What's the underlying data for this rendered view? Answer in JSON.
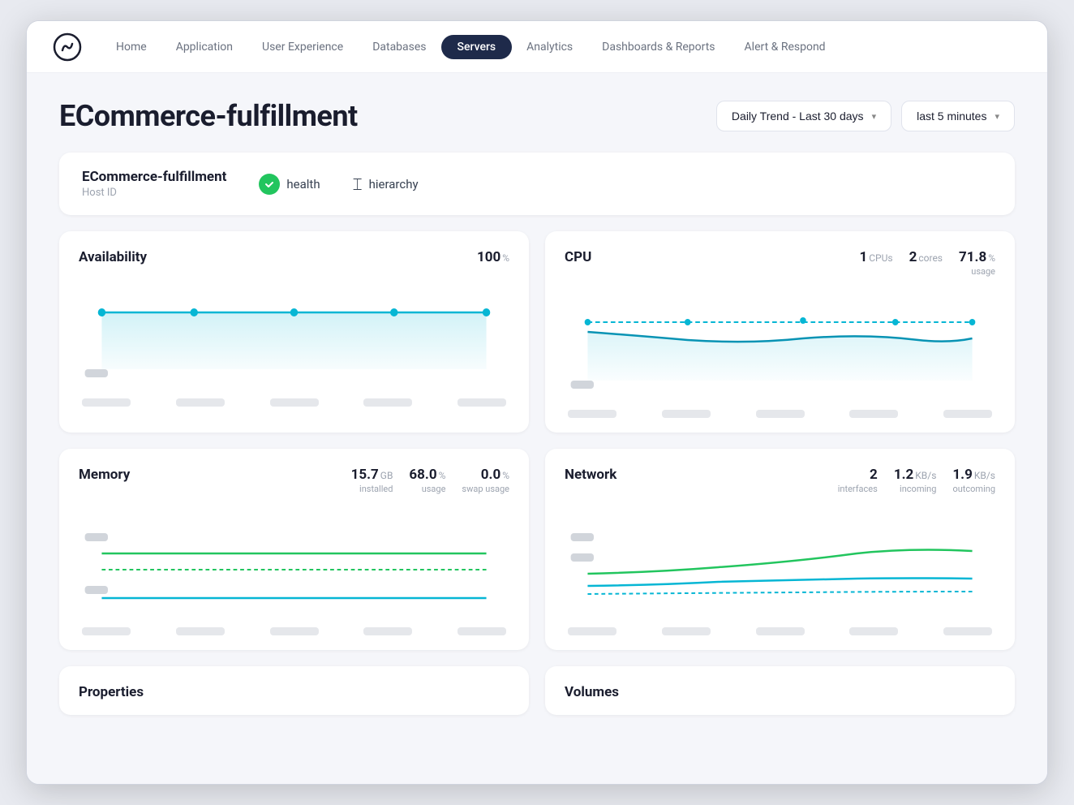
{
  "nav": {
    "logo_alt": "logo",
    "items": [
      {
        "label": "Home",
        "active": false
      },
      {
        "label": "Application",
        "active": false
      },
      {
        "label": "User Experience",
        "active": false
      },
      {
        "label": "Databases",
        "active": false
      },
      {
        "label": "Servers",
        "active": true
      },
      {
        "label": "Analytics",
        "active": false
      },
      {
        "label": "Dashboards & Reports",
        "active": false
      },
      {
        "label": "Alert & Respond",
        "active": false
      }
    ]
  },
  "page": {
    "title": "ECommerce-fulfillment",
    "trend_dropdown": "Daily Trend - Last 30 days",
    "time_dropdown": "last 5 minutes"
  },
  "info_card": {
    "name": "ECommerce-fulfillment",
    "sub": "Host ID",
    "health_label": "health",
    "hierarchy_label": "hierarchy"
  },
  "availability": {
    "title": "Availability",
    "value": "100",
    "unit": "%"
  },
  "cpu": {
    "title": "CPU",
    "cpus_value": "1",
    "cpus_label": "CPUs",
    "cores_value": "2",
    "cores_label": "cores",
    "usage_value": "71.8",
    "usage_unit": "%",
    "usage_label": "usage"
  },
  "memory": {
    "title": "Memory",
    "installed_value": "15.7",
    "installed_unit": "GB",
    "installed_label": "installed",
    "usage_value": "68.0",
    "usage_unit": "%",
    "usage_label": "usage",
    "swap_value": "0.0",
    "swap_unit": "%",
    "swap_label": "swap usage"
  },
  "network": {
    "title": "Network",
    "interfaces_value": "2",
    "interfaces_label": "interfaces",
    "incoming_value": "1.2",
    "incoming_unit": "KB/s",
    "incoming_label": "incoming",
    "outgoing_value": "1.9",
    "outgoing_unit": "KB/s",
    "outgoing_label": "outcoming"
  },
  "properties": {
    "title": "Properties"
  },
  "volumes": {
    "title": "Volumes"
  }
}
